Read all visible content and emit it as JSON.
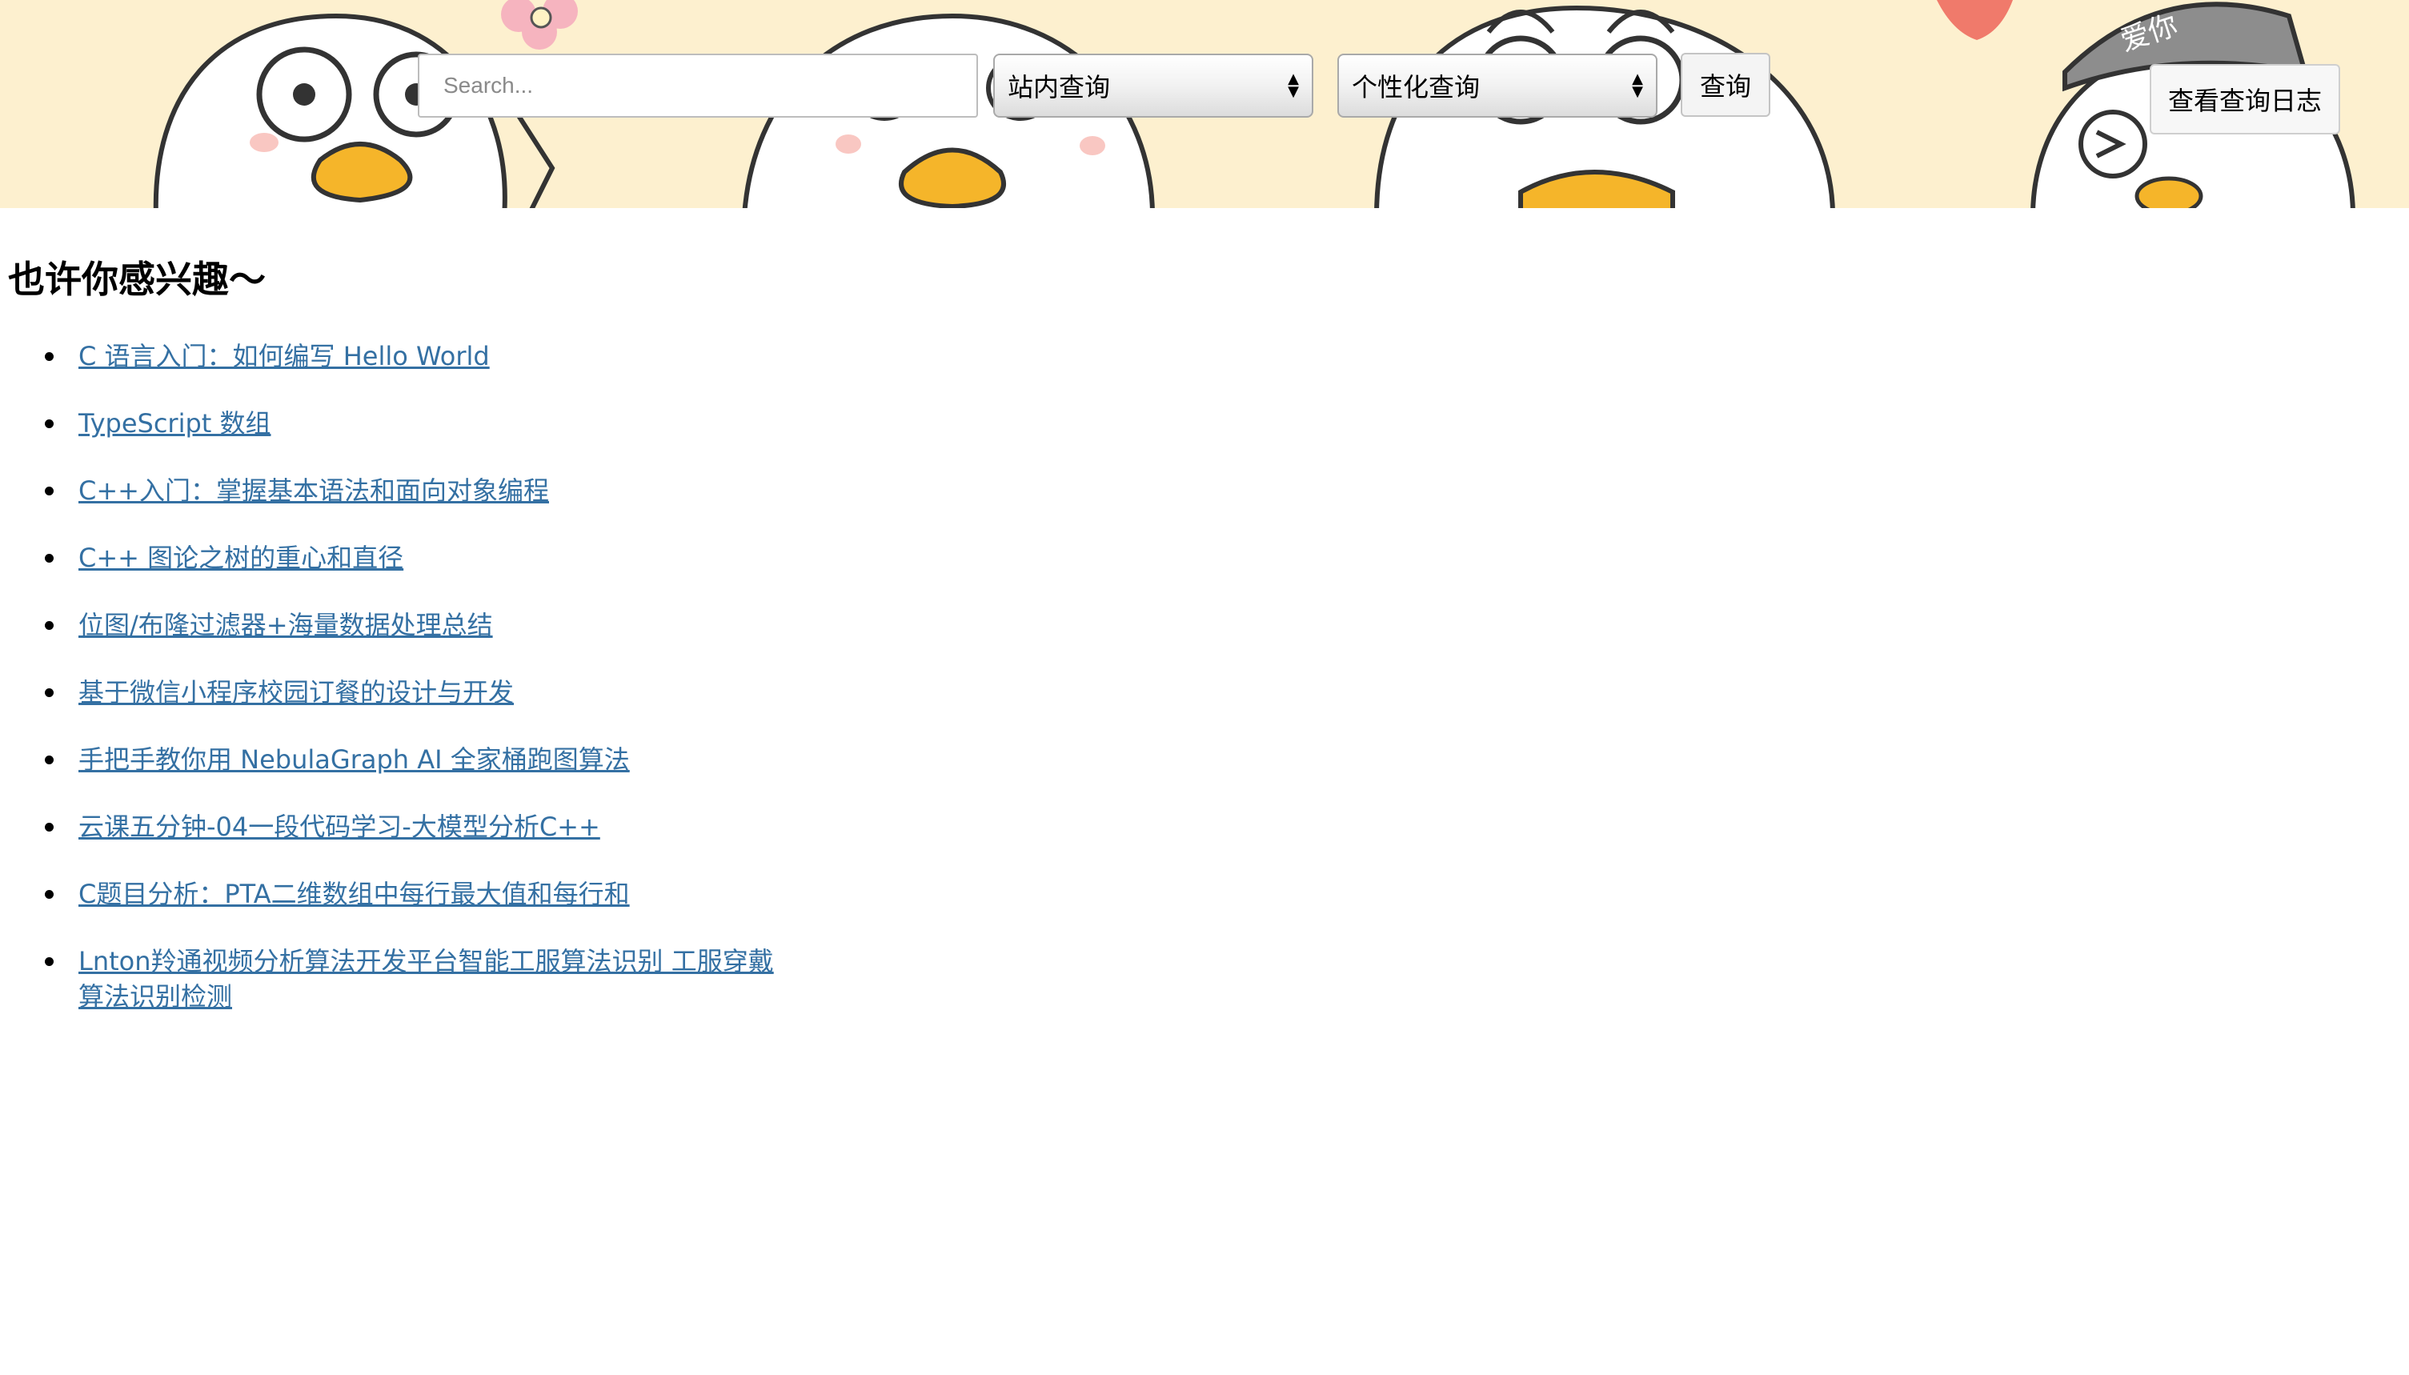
{
  "header": {
    "search": {
      "placeholder": "Search...",
      "value": ""
    },
    "scope_select": {
      "selected": "站内查询"
    },
    "mode_select": {
      "selected": "个性化查询"
    },
    "query_button": "查询",
    "log_button": "查看查询日志",
    "banner_text": "爱你"
  },
  "recommendations": {
    "heading": "也许你感兴趣～",
    "items": [
      {
        "label": "C 语言入门：如何编写 Hello World"
      },
      {
        "label": "TypeScript 数组"
      },
      {
        "label": "C++入门：掌握基本语法和面向对象编程"
      },
      {
        "label": "C++ 图论之树的重心和直径"
      },
      {
        "label": "位图/布隆过滤器+海量数据处理总结"
      },
      {
        "label": "基于微信小程序校园订餐的设计与开发"
      },
      {
        "label": "手把手教你用 NebulaGraph AI 全家桶跑图算法"
      },
      {
        "label": "云课五分钟-04一段代码学习-大模型分析C++"
      },
      {
        "label": "C题目分析：PTA二维数组中每行最大值和每行和"
      },
      {
        "label": "Lnton羚通视频分析算法开发平台智能工服算法识别 工服穿戴算法识别检测"
      }
    ]
  },
  "colors": {
    "banner_bg": "#fdf0cf",
    "link": "#3470a3",
    "beak": "#f5b52a"
  }
}
